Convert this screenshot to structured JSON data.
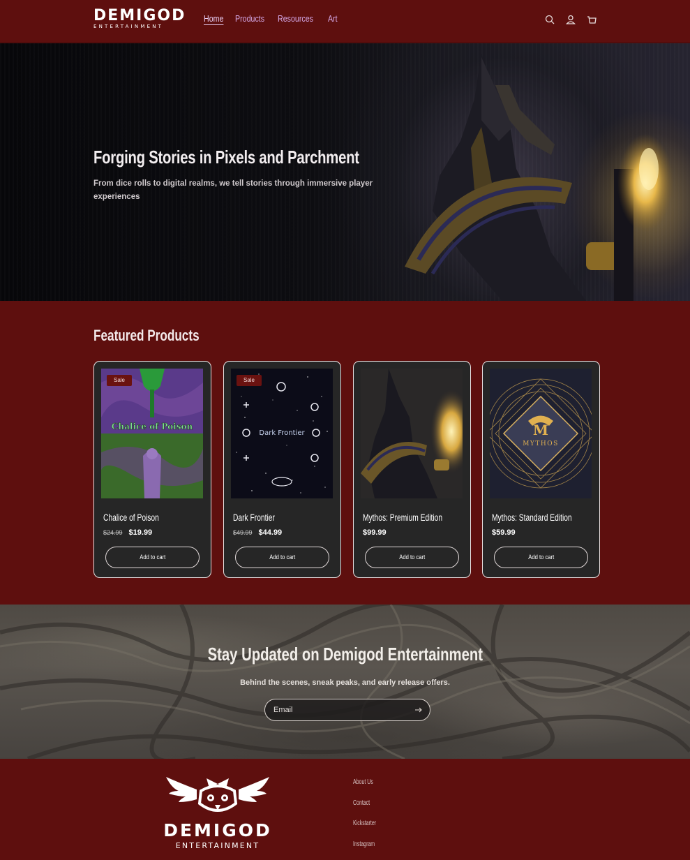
{
  "brand": {
    "name": "DEMIGOD",
    "tagline": "ENTERTAINMENT"
  },
  "nav": [
    {
      "label": "Home",
      "active": true
    },
    {
      "label": "Products",
      "active": false
    },
    {
      "label": "Resources",
      "active": false
    },
    {
      "label": "Art",
      "active": false
    }
  ],
  "header_icons": [
    "search-icon",
    "account-icon",
    "cart-icon"
  ],
  "hero": {
    "title": "Forging Stories in Pixels and Parchment",
    "subtitle": "From dice rolls to digital realms, we tell stories through immersive player experiences"
  },
  "featured": {
    "title": "Featured Products",
    "products": [
      {
        "name": "Chalice of Poison",
        "sale": true,
        "badge": "Sale",
        "old_price": "$24.99",
        "price": "$19.99",
        "button": "Add to cart",
        "art_text": "Chalice of Poison"
      },
      {
        "name": "Dark Frontier",
        "sale": true,
        "badge": "Sale",
        "old_price": "$49.99",
        "price": "$44.99",
        "button": "Add to cart",
        "art_text": "Dark Frontier"
      },
      {
        "name": "Mythos: Premium Edition",
        "sale": false,
        "badge": "",
        "old_price": "",
        "price": "$99.99",
        "button": "Add to cart",
        "art_text": ""
      },
      {
        "name": "Mythos: Standard Edition",
        "sale": false,
        "badge": "",
        "old_price": "",
        "price": "$59.99",
        "button": "Add to cart",
        "art_text": "MYTHOS"
      }
    ]
  },
  "newsletter": {
    "title": "Stay Updated on Demigod Entertainment",
    "subtitle": "Behind the scenes, sneak peaks, and early release offers.",
    "email_placeholder": "Email"
  },
  "footer": {
    "links": [
      "About Us",
      "Contact",
      "Kickstarter",
      "Instagram"
    ]
  },
  "colors": {
    "brand_red": "#5e0f0e",
    "card_bg": "#262626",
    "nav_link": "#d6a9e8"
  }
}
